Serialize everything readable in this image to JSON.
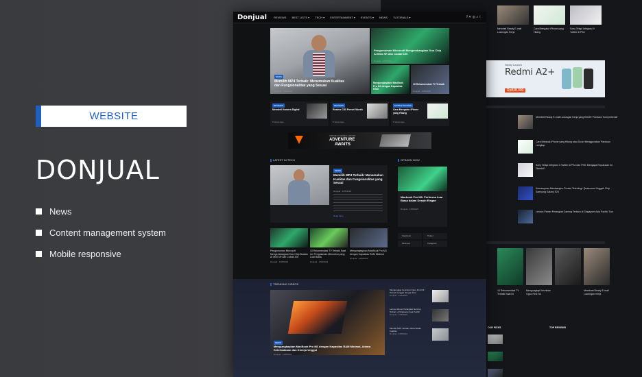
{
  "badge": {
    "label": "WEBSITE"
  },
  "brand": {
    "name": "DONJUAL"
  },
  "features": [
    "News",
    "Content management system",
    "Mobile responsive"
  ],
  "colors": {
    "accent": "#1f5fbf",
    "background": "#3a3b3f",
    "mock_bg": "#111214"
  },
  "mock": {
    "logo": "Donjual",
    "nav": [
      "REVIEWS",
      "BEST LISTS ▾",
      "TECH ▾",
      "ENTERTAINMENT ▾",
      "EVENTS ▾",
      "NEWS",
      "TUTORIALS ▾"
    ],
    "nav_icons": "f  ✕  ◎  ⌕  ☾",
    "hero": {
      "tag": "NEWS",
      "title": "Memilih MP4 Terbaik: Menemukan Kualitas dan Fungsionalitas yang Sesuai",
      "meta": "Donjual  ·  1/05/2024",
      "side1_title": "Pengumuman Microsoft Mengembangkan Duo Chip Ai Mini XR dan Cobalt 100",
      "side1_meta": "Donjual · 1/05/2024",
      "side2_title": "Mengungkapkan MacBook Pro M3 dengan Kapasitas RAM",
      "side3_title": "10 Rekomendasi TV Terbaik",
      "side3_meta": "Donjual · 1/05/2024"
    },
    "small_cards": [
      {
        "tag": "REVIEWS",
        "title": "Membeli Kamera Digital",
        "meta": "5 Views Ago"
      },
      {
        "tag": "REVIEWS",
        "title": "Realme C53 Ponsel Murah",
        "meta": "5 Views Ago"
      },
      {
        "tag": "MOBILE PHONES",
        "title": "Cara Mengatur iPhone yang Hilang",
        "meta": "5 Views Ago"
      }
    ],
    "ad": {
      "small": "VIRTUE S SERIES LAPTOP",
      "big1": "ADVENTURE",
      "big2": "AWAITS"
    },
    "latest_tech": {
      "section": "LATEST IN TECH",
      "tag": "NEWS",
      "title": "Memilih MP4 Terbaik: Menemukan Kualitas dan Fungsionalitas yang Sesuai",
      "meta": "Donjual  ·  1/05/2024",
      "more": "Read More"
    },
    "thumbs": [
      {
        "title": "Pengumuman Microsoft Mengembangkan Duo Chip Buatan AI Mini XR dan Cobalt 100",
        "meta": "Donjual · 1/05/2024"
      },
      {
        "title": "10 Rekomendasi TV Terbaik Saat Ini: Pengalaman Menonton yang Luar Biasa",
        "meta": "Donjual · 1/05/2024"
      },
      {
        "title": "Mengungkapkan MacBook Pro M3 dengan Kapasitas RAM Minimal",
        "meta": "Donjual · 1/05/2024"
      }
    ],
    "news_side": {
      "section": "OPINION NOW",
      "title": "Macbook Pro M3: Performa Luar Biasa dalam Desain Elegan",
      "meta": "Donjual · 1/05/2024"
    },
    "social": [
      "Facebook",
      "Twitter",
      "Pinterest",
      "Instagram"
    ],
    "trending": {
      "section": "TRENDING VIDEOS",
      "tag": "NEWS",
      "title": "Mengungkapkan MacBook Pro M3 dengan Kapasitas RAM Minimal, Antara Keterbatasan dan Kinerja Unggul",
      "meta": "Donjual · 1/05/2024",
      "items": [
        {
          "title": "Mengungkap Keunikan Oppo Find N3: Ponsel Canggih dengan Fitur",
          "meta": "Donjual · 1/05/2024"
        },
        {
          "title": "Lenovo Pamer Perangkat Gaming Terbaru di Singapore Asia Pacific",
          "meta": "Donjual · 1/05/2024"
        },
        {
          "title": "Memilih MP4 Terbaik: Menemukan Kualitas",
          "meta": "Donjual · 1/05/2024"
        }
      ]
    }
  },
  "back": {
    "top_cards": [
      {
        "title": "Membeli Ready E-mail Lowongan Kerja",
        "meta": "Donjual"
      },
      {
        "title": "Cara Mengatur iPhone yang Hilang",
        "meta": "Donjual"
      },
      {
        "title": "Sony Tetapi Integrasi X Twitter di PS4",
        "meta": "Donjual"
      }
    ],
    "redmi": {
      "sub": "Newly Launch",
      "title": "Redmi A2+",
      "price": "Rp848.000"
    },
    "list": [
      {
        "title": "Membeli Ready E-mail Lowongan Kerja yang Efektif: Panduan Komprehensif"
      },
      {
        "title": "Cara Melacak iPhone yang Hilang atau Dicuri Menggunakan Panduan Lengkap"
      },
      {
        "title": "Sony Tetapi Integrasi X Twitter di PS4 dan PS5: Mengapa Keputusan Ini Diambil?"
      },
      {
        "title": "Kemampuan Membangun Proses Teknologi: Qualcomm Unggah Chip Samsung Galaxy S24"
      },
      {
        "title": "Lenovo Pamer Perangkat Gaming Terbaru di Singapore Asia Pacific Tour"
      }
    ],
    "strip": [
      {
        "title": "10 Rekomendasi TV Terbaik Saat Ini"
      },
      {
        "title": "Mengungkap Keunikan Oppo Find N3"
      },
      {
        "title": "Membuat Ready E-mail Lowongan Kerja"
      }
    ],
    "our_picks": "OUR PICKS",
    "top_reviews": "TOP REVIEWS"
  }
}
